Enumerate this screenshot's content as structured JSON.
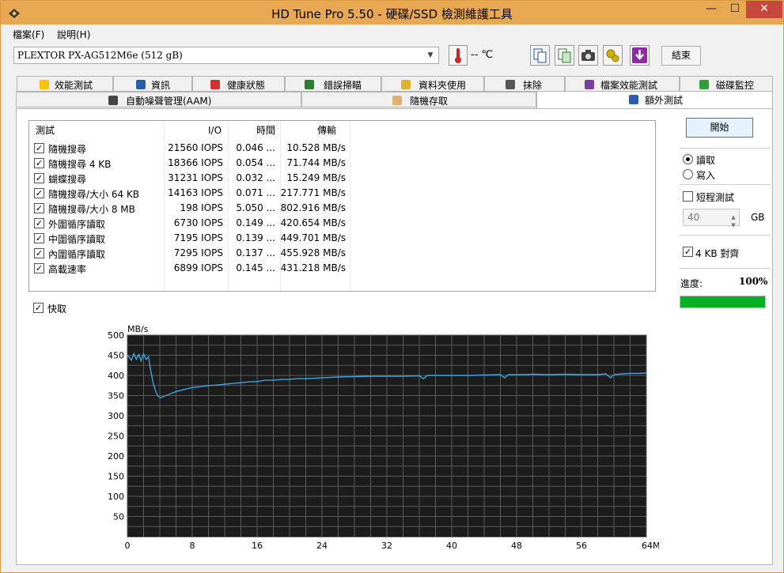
{
  "window": {
    "title": "HD Tune Pro 5.50 - 硬碟/SSD 檢測維護工具"
  },
  "menu": {
    "file": "檔案(F)",
    "help": "說明(H)"
  },
  "toolbar": {
    "drive": "PLEXTOR PX-AG512M6e (512 gB)",
    "temperature": "-- ℃",
    "exit_label": "結束"
  },
  "tabs_row1": [
    {
      "label": "效能測試",
      "icon": "lightbulb-icon"
    },
    {
      "label": "資訊",
      "icon": "info-icon"
    },
    {
      "label": "健康狀態",
      "icon": "health-cross-icon"
    },
    {
      "label": "錯誤掃瞄",
      "icon": "magnifier-icon"
    },
    {
      "label": "資料夾使用",
      "icon": "folder-icon"
    },
    {
      "label": "抹除",
      "icon": "trash-icon"
    },
    {
      "label": "檔案效能測試",
      "icon": "file-benchmark-icon"
    },
    {
      "label": "磁碟監控",
      "icon": "monitor-chart-icon"
    }
  ],
  "tabs_row2": [
    {
      "label": "自動噪聲管理(AAM)",
      "icon": "speaker-icon"
    },
    {
      "label": "隨機存取",
      "icon": "random-access-icon"
    },
    {
      "label": "額外測試",
      "icon": "extra-tests-icon",
      "active": true
    }
  ],
  "results": {
    "headers": {
      "test": "測試",
      "io": "I/O",
      "time": "時間",
      "transfer": "傳輸"
    },
    "rows": [
      {
        "checked": true,
        "test": "隨機搜尋",
        "io": "21560 IOPS",
        "time": "0.046 ...",
        "transfer": "10.528 MB/s"
      },
      {
        "checked": true,
        "test": "隨機搜尋 4 KB",
        "io": "18366 IOPS",
        "time": "0.054 ...",
        "transfer": "71.744 MB/s"
      },
      {
        "checked": true,
        "test": "蝴蝶搜尋",
        "io": "31231 IOPS",
        "time": "0.032 ...",
        "transfer": "15.249 MB/s"
      },
      {
        "checked": true,
        "test": "隨機搜尋/大小 64 KB",
        "io": "14163 IOPS",
        "time": "0.071 ...",
        "transfer": "217.771 MB/s"
      },
      {
        "checked": true,
        "test": "隨機搜尋/大小 8 MB",
        "io": "198 IOPS",
        "time": "5.050 ...",
        "transfer": "802.916 MB/s"
      },
      {
        "checked": true,
        "test": "外圍循序讀取",
        "io": "6730 IOPS",
        "time": "0.149 ...",
        "transfer": "420.654 MB/s"
      },
      {
        "checked": true,
        "test": "中圍循序讀取",
        "io": "7195 IOPS",
        "time": "0.139 ...",
        "transfer": "449.701 MB/s"
      },
      {
        "checked": true,
        "test": "內圍循序讀取",
        "io": "7295 IOPS",
        "time": "0.137 ...",
        "transfer": "455.928 MB/s"
      },
      {
        "checked": true,
        "test": "高載速率",
        "io": "6899 IOPS",
        "time": "0.145 ...",
        "transfer": "431.218 MB/s"
      }
    ]
  },
  "cache_label": "快取",
  "cache_checked": true,
  "panel": {
    "start_label": "開始",
    "read_label": "讀取",
    "write_label": "寫入",
    "read_selected": true,
    "short_test_label": "短程測試",
    "short_test_checked": false,
    "size_value": "40",
    "size_unit": "GB",
    "align_label": "4 KB 對齊",
    "align_checked": true,
    "progress_label": "進度:",
    "progress_text": "100%",
    "progress_value": 1.0
  },
  "chart_data": {
    "type": "line",
    "ylabel": "MB/s",
    "xlabel": "MB",
    "ylim": [
      0,
      500
    ],
    "xlim": [
      0,
      64
    ],
    "yticks": [
      50,
      100,
      150,
      200,
      250,
      300,
      350,
      400,
      450,
      500
    ],
    "xticks": [
      0,
      8,
      16,
      24,
      32,
      40,
      48,
      56,
      64
    ],
    "xtick_labels": [
      "0",
      "8",
      "16",
      "24",
      "32",
      "40",
      "48",
      "56",
      "64MB"
    ],
    "grid": true,
    "line_color": "#3aa6e0",
    "x": [
      0,
      0.5,
      0.8,
      1.1,
      1.4,
      1.7,
      2.0,
      2.3,
      2.6,
      2.9,
      3.2,
      3.5,
      3.8,
      4.1,
      4.4,
      4.7,
      5.0,
      5.5,
      6.0,
      7.0,
      8.0,
      9.0,
      10.0,
      11.0,
      12.0,
      13.0,
      14.0,
      15.0,
      16.0,
      17.0,
      18.0,
      19.0,
      20.0,
      21.0,
      22.0,
      23.0,
      24.0,
      26.0,
      28.0,
      30.0,
      32.0,
      34.0,
      36.0,
      36.5,
      37.0,
      38.0,
      40.0,
      42.0,
      44.0,
      46.0,
      46.5,
      47.0,
      48.0,
      49.0,
      50.0,
      52.0,
      54.0,
      56.0,
      58.0,
      59.0,
      59.6,
      60.0,
      61.0,
      62.0,
      63.0,
      64.0
    ],
    "y": [
      450,
      438,
      454,
      440,
      452,
      436,
      454,
      440,
      446,
      410,
      380,
      360,
      348,
      345,
      347,
      350,
      352,
      356,
      360,
      365,
      370,
      372,
      375,
      376,
      378,
      380,
      382,
      384,
      385,
      388,
      388,
      390,
      390,
      392,
      392,
      393,
      394,
      396,
      397,
      398,
      398,
      398,
      399,
      392,
      400,
      400,
      400,
      400,
      401,
      402,
      394,
      402,
      402,
      402,
      403,
      402,
      403,
      402,
      402,
      404,
      394,
      402,
      404,
      405,
      405,
      406
    ]
  }
}
